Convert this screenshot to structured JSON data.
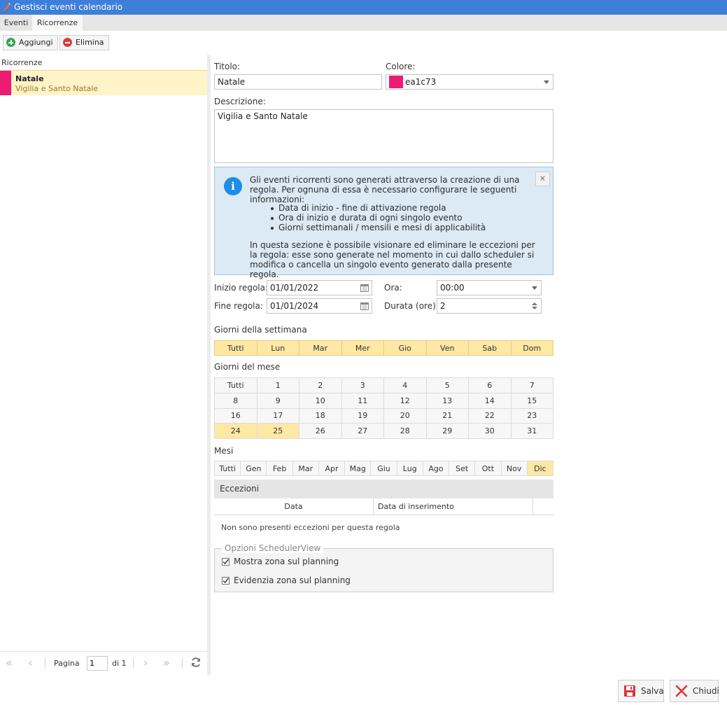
{
  "window": {
    "title": "Gestisci eventi calendario"
  },
  "tabs": [
    {
      "label": "Eventi"
    },
    {
      "label": "Ricorrenze"
    }
  ],
  "toolbar": {
    "add_label": "Aggiungi",
    "delete_label": "Elimina"
  },
  "list": {
    "header": "Ricorrenze",
    "items": [
      {
        "name": "Natale",
        "description": "Vigilia e Santo Natale",
        "color": "#ea1c73"
      }
    ]
  },
  "pager": {
    "page_label": "Pagina",
    "page_value": "1",
    "of_label": "di 1"
  },
  "form": {
    "title_label": "Titolo:",
    "title_value": "Natale",
    "color_label": "Colore:",
    "color_value": "ea1c73",
    "color_hex": "#ea1c73",
    "description_label": "Descrizione:",
    "description_value": "Vigilia e Santo Natale",
    "start_label": "Inizio regola:",
    "start_value": "01/01/2022",
    "end_label": "Fine regola:",
    "end_value": "01/01/2024",
    "time_label": "Ora:",
    "time_value": "00:00",
    "duration_label": "Durata (ore):",
    "duration_value": "2"
  },
  "info": {
    "line1": "Gli eventi ricorrenti sono generati attraverso la creazione di una regola. Per ognuna di essa è necessario configurare le seguenti informazioni:",
    "bullets": [
      "Data di inizio - fine di attivazione regola",
      "Ora di inizio e durata di ogni singolo evento",
      "Giorni settimanali / mensili e mesi di applicabilità"
    ],
    "line2": "In questa sezione è possibile visionare ed eliminare le eccezioni per la regola: esse sono generate nel momento in cui dallo scheduler si modifica o cancella un singolo evento generato dalla presente regola.",
    "close_symbol": "×"
  },
  "weekdays": {
    "title": "Giorni della settimana",
    "items": [
      "Tutti",
      "Lun",
      "Mar",
      "Mer",
      "Gio",
      "Ven",
      "Sab",
      "Dom"
    ],
    "selected": [
      "Tutti",
      "Lun",
      "Mar",
      "Mer",
      "Gio",
      "Ven",
      "Sab",
      "Dom"
    ]
  },
  "monthdays": {
    "title": "Giorni del mese",
    "items": [
      "Tutti",
      "1",
      "2",
      "3",
      "4",
      "5",
      "6",
      "7",
      "8",
      "9",
      "10",
      "11",
      "12",
      "13",
      "14",
      "15",
      "16",
      "17",
      "18",
      "19",
      "20",
      "21",
      "22",
      "23",
      "24",
      "25",
      "26",
      "27",
      "28",
      "29",
      "30",
      "31"
    ],
    "selected": [
      "24",
      "25"
    ]
  },
  "months": {
    "title": "Mesi",
    "items": [
      "Tutti",
      "Gen",
      "Feb",
      "Mar",
      "Apr",
      "Mag",
      "Giu",
      "Lug",
      "Ago",
      "Set",
      "Ott",
      "Nov",
      "Dic"
    ],
    "selected": [
      "Dic"
    ]
  },
  "exceptions": {
    "title": "Eccezioni",
    "columns": [
      "Data",
      "Data di inserimento"
    ],
    "empty_text": "Non sono presenti eccezioni per questa regola"
  },
  "scheduler_options": {
    "legend": "Opzioni SchedulerView",
    "show_zone": {
      "label": "Mostra zona sul planning",
      "checked": true
    },
    "highlight_zone": {
      "label": "Evidenzia zona sul planning",
      "checked": true
    }
  },
  "footer": {
    "save_label": "Salva",
    "close_label": "Chiudi"
  },
  "colors": {
    "titlebar": "#3d7fd9",
    "selection": "#fde8a4",
    "info_background": "#dbeaf5",
    "info_icon": "#1f8ce6",
    "add_icon": "#2fa84f",
    "delete_icon": "#e03b3b",
    "save_icon": "#d9343d",
    "close_icon": "#d9343d"
  }
}
